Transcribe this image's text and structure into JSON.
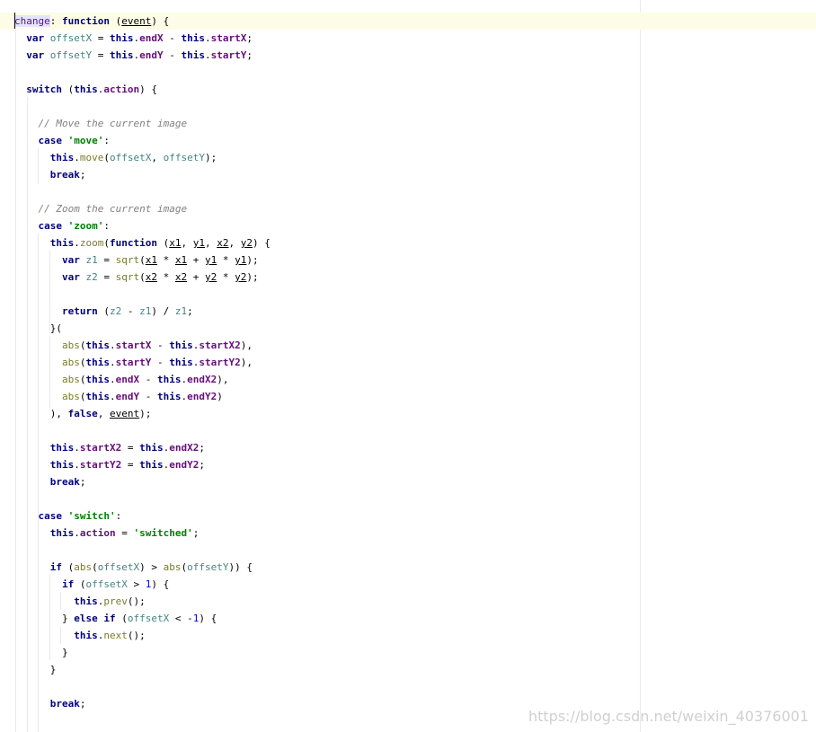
{
  "editor": {
    "lines": [
      [
        [
          "label",
          "change"
        ],
        [
          "p",
          ": "
        ],
        [
          "kw",
          "function"
        ],
        [
          "p",
          " ("
        ],
        [
          "param",
          "event"
        ],
        [
          "p",
          ") {"
        ]
      ],
      [
        [
          "p",
          "  "
        ],
        [
          "kw",
          "var"
        ],
        [
          "p",
          " "
        ],
        [
          "var",
          "offsetX"
        ],
        [
          "p",
          " = "
        ],
        [
          "this",
          "this"
        ],
        [
          "p",
          "."
        ],
        [
          "prop",
          "endX"
        ],
        [
          "p",
          " - "
        ],
        [
          "this",
          "this"
        ],
        [
          "p",
          "."
        ],
        [
          "prop",
          "startX"
        ],
        [
          "p",
          ";"
        ]
      ],
      [
        [
          "p",
          "  "
        ],
        [
          "kw",
          "var"
        ],
        [
          "p",
          " "
        ],
        [
          "var",
          "offsetY"
        ],
        [
          "p",
          " = "
        ],
        [
          "this",
          "this"
        ],
        [
          "p",
          "."
        ],
        [
          "prop",
          "endY"
        ],
        [
          "p",
          " - "
        ],
        [
          "this",
          "this"
        ],
        [
          "p",
          "."
        ],
        [
          "prop",
          "startY"
        ],
        [
          "p",
          ";"
        ]
      ],
      [],
      [
        [
          "p",
          "  "
        ],
        [
          "kw",
          "switch"
        ],
        [
          "p",
          " ("
        ],
        [
          "this",
          "this"
        ],
        [
          "p",
          "."
        ],
        [
          "prop",
          "action"
        ],
        [
          "p",
          ") {"
        ]
      ],
      [],
      [
        [
          "p",
          "    "
        ],
        [
          "cmt",
          "// Move the current image"
        ]
      ],
      [
        [
          "p",
          "    "
        ],
        [
          "kw",
          "case"
        ],
        [
          "p",
          " "
        ],
        [
          "str",
          "'move'"
        ],
        [
          "p",
          ":"
        ]
      ],
      [
        [
          "p",
          "      "
        ],
        [
          "this",
          "this"
        ],
        [
          "p",
          "."
        ],
        [
          "fn",
          "move"
        ],
        [
          "p",
          "("
        ],
        [
          "var",
          "offsetX"
        ],
        [
          "p",
          ", "
        ],
        [
          "var",
          "offsetY"
        ],
        [
          "p",
          ");"
        ]
      ],
      [
        [
          "p",
          "      "
        ],
        [
          "kw",
          "break"
        ],
        [
          "p",
          ";"
        ]
      ],
      [],
      [
        [
          "p",
          "    "
        ],
        [
          "cmt",
          "// Zoom the current image"
        ]
      ],
      [
        [
          "p",
          "    "
        ],
        [
          "kw",
          "case"
        ],
        [
          "p",
          " "
        ],
        [
          "str",
          "'zoom'"
        ],
        [
          "p",
          ":"
        ]
      ],
      [
        [
          "p",
          "      "
        ],
        [
          "this",
          "this"
        ],
        [
          "p",
          "."
        ],
        [
          "fn",
          "zoom"
        ],
        [
          "p",
          "("
        ],
        [
          "kw",
          "function"
        ],
        [
          "p",
          " ("
        ],
        [
          "param",
          "x1"
        ],
        [
          "p",
          ", "
        ],
        [
          "param",
          "y1"
        ],
        [
          "p",
          ", "
        ],
        [
          "param",
          "x2"
        ],
        [
          "p",
          ", "
        ],
        [
          "param",
          "y2"
        ],
        [
          "p",
          ") {"
        ]
      ],
      [
        [
          "p",
          "        "
        ],
        [
          "kw",
          "var"
        ],
        [
          "p",
          " "
        ],
        [
          "var",
          "z1"
        ],
        [
          "p",
          " = "
        ],
        [
          "fn",
          "sqrt"
        ],
        [
          "p",
          "("
        ],
        [
          "param",
          "x1"
        ],
        [
          "p",
          " * "
        ],
        [
          "param",
          "x1"
        ],
        [
          "p",
          " + "
        ],
        [
          "param",
          "y1"
        ],
        [
          "p",
          " * "
        ],
        [
          "param",
          "y1"
        ],
        [
          "p",
          ");"
        ]
      ],
      [
        [
          "p",
          "        "
        ],
        [
          "kw",
          "var"
        ],
        [
          "p",
          " "
        ],
        [
          "var",
          "z2"
        ],
        [
          "p",
          " = "
        ],
        [
          "fn",
          "sqrt"
        ],
        [
          "p",
          "("
        ],
        [
          "param",
          "x2"
        ],
        [
          "p",
          " * "
        ],
        [
          "param",
          "x2"
        ],
        [
          "p",
          " + "
        ],
        [
          "param",
          "y2"
        ],
        [
          "p",
          " * "
        ],
        [
          "param",
          "y2"
        ],
        [
          "p",
          ");"
        ]
      ],
      [],
      [
        [
          "p",
          "        "
        ],
        [
          "kw",
          "return"
        ],
        [
          "p",
          " ("
        ],
        [
          "var",
          "z2"
        ],
        [
          "p",
          " - "
        ],
        [
          "var",
          "z1"
        ],
        [
          "p",
          ") / "
        ],
        [
          "var",
          "z1"
        ],
        [
          "p",
          ";"
        ]
      ],
      [
        [
          "p",
          "      }("
        ]
      ],
      [
        [
          "p",
          "        "
        ],
        [
          "fn",
          "abs"
        ],
        [
          "p",
          "("
        ],
        [
          "this",
          "this"
        ],
        [
          "p",
          "."
        ],
        [
          "prop",
          "startX"
        ],
        [
          "p",
          " - "
        ],
        [
          "this",
          "this"
        ],
        [
          "p",
          "."
        ],
        [
          "prop",
          "startX2"
        ],
        [
          "p",
          "),"
        ]
      ],
      [
        [
          "p",
          "        "
        ],
        [
          "fn",
          "abs"
        ],
        [
          "p",
          "("
        ],
        [
          "this",
          "this"
        ],
        [
          "p",
          "."
        ],
        [
          "prop",
          "startY"
        ],
        [
          "p",
          " - "
        ],
        [
          "this",
          "this"
        ],
        [
          "p",
          "."
        ],
        [
          "prop",
          "startY2"
        ],
        [
          "p",
          "),"
        ]
      ],
      [
        [
          "p",
          "        "
        ],
        [
          "fn",
          "abs"
        ],
        [
          "p",
          "("
        ],
        [
          "this",
          "this"
        ],
        [
          "p",
          "."
        ],
        [
          "prop",
          "endX"
        ],
        [
          "p",
          " - "
        ],
        [
          "this",
          "this"
        ],
        [
          "p",
          "."
        ],
        [
          "prop",
          "endX2"
        ],
        [
          "p",
          "),"
        ]
      ],
      [
        [
          "p",
          "        "
        ],
        [
          "fn",
          "abs"
        ],
        [
          "p",
          "("
        ],
        [
          "this",
          "this"
        ],
        [
          "p",
          "."
        ],
        [
          "prop",
          "endY"
        ],
        [
          "p",
          " - "
        ],
        [
          "this",
          "this"
        ],
        [
          "p",
          "."
        ],
        [
          "prop",
          "endY2"
        ],
        [
          "p",
          ")"
        ]
      ],
      [
        [
          "p",
          "      ), "
        ],
        [
          "kw",
          "false"
        ],
        [
          "p",
          ", "
        ],
        [
          "param",
          "event"
        ],
        [
          "p",
          ");"
        ]
      ],
      [],
      [
        [
          "p",
          "      "
        ],
        [
          "this",
          "this"
        ],
        [
          "p",
          "."
        ],
        [
          "prop",
          "startX2"
        ],
        [
          "p",
          " = "
        ],
        [
          "this",
          "this"
        ],
        [
          "p",
          "."
        ],
        [
          "prop",
          "endX2"
        ],
        [
          "p",
          ";"
        ]
      ],
      [
        [
          "p",
          "      "
        ],
        [
          "this",
          "this"
        ],
        [
          "p",
          "."
        ],
        [
          "prop",
          "startY2"
        ],
        [
          "p",
          " = "
        ],
        [
          "this",
          "this"
        ],
        [
          "p",
          "."
        ],
        [
          "prop",
          "endY2"
        ],
        [
          "p",
          ";"
        ]
      ],
      [
        [
          "p",
          "      "
        ],
        [
          "kw",
          "break"
        ],
        [
          "p",
          ";"
        ]
      ],
      [],
      [
        [
          "p",
          "    "
        ],
        [
          "kw",
          "case"
        ],
        [
          "p",
          " "
        ],
        [
          "str",
          "'switch'"
        ],
        [
          "p",
          ":"
        ]
      ],
      [
        [
          "p",
          "      "
        ],
        [
          "this",
          "this"
        ],
        [
          "p",
          "."
        ],
        [
          "prop",
          "action"
        ],
        [
          "p",
          " = "
        ],
        [
          "str",
          "'switched'"
        ],
        [
          "p",
          ";"
        ]
      ],
      [],
      [
        [
          "p",
          "      "
        ],
        [
          "kw",
          "if"
        ],
        [
          "p",
          " ("
        ],
        [
          "fn",
          "abs"
        ],
        [
          "p",
          "("
        ],
        [
          "var",
          "offsetX"
        ],
        [
          "p",
          ") > "
        ],
        [
          "fn",
          "abs"
        ],
        [
          "p",
          "("
        ],
        [
          "var",
          "offsetY"
        ],
        [
          "p",
          ")) {"
        ]
      ],
      [
        [
          "p",
          "        "
        ],
        [
          "kw",
          "if"
        ],
        [
          "p",
          " ("
        ],
        [
          "var",
          "offsetX"
        ],
        [
          "p",
          " > "
        ],
        [
          "num",
          "1"
        ],
        [
          "p",
          ") {"
        ]
      ],
      [
        [
          "p",
          "          "
        ],
        [
          "this",
          "this"
        ],
        [
          "p",
          "."
        ],
        [
          "fn",
          "prev"
        ],
        [
          "p",
          "();"
        ]
      ],
      [
        [
          "p",
          "        } "
        ],
        [
          "kw",
          "else if"
        ],
        [
          "p",
          " ("
        ],
        [
          "var",
          "offsetX"
        ],
        [
          "p",
          " < -"
        ],
        [
          "num",
          "1"
        ],
        [
          "p",
          ") {"
        ]
      ],
      [
        [
          "p",
          "          "
        ],
        [
          "this",
          "this"
        ],
        [
          "p",
          "."
        ],
        [
          "fn",
          "next"
        ],
        [
          "p",
          "();"
        ]
      ],
      [
        [
          "p",
          "        }"
        ]
      ],
      [
        [
          "p",
          "      }"
        ]
      ],
      [],
      [
        [
          "p",
          "      "
        ],
        [
          "kw",
          "break"
        ],
        [
          "p",
          ";"
        ]
      ]
    ]
  },
  "watermark": "https://blog.csdn.net/weixin_40376001"
}
